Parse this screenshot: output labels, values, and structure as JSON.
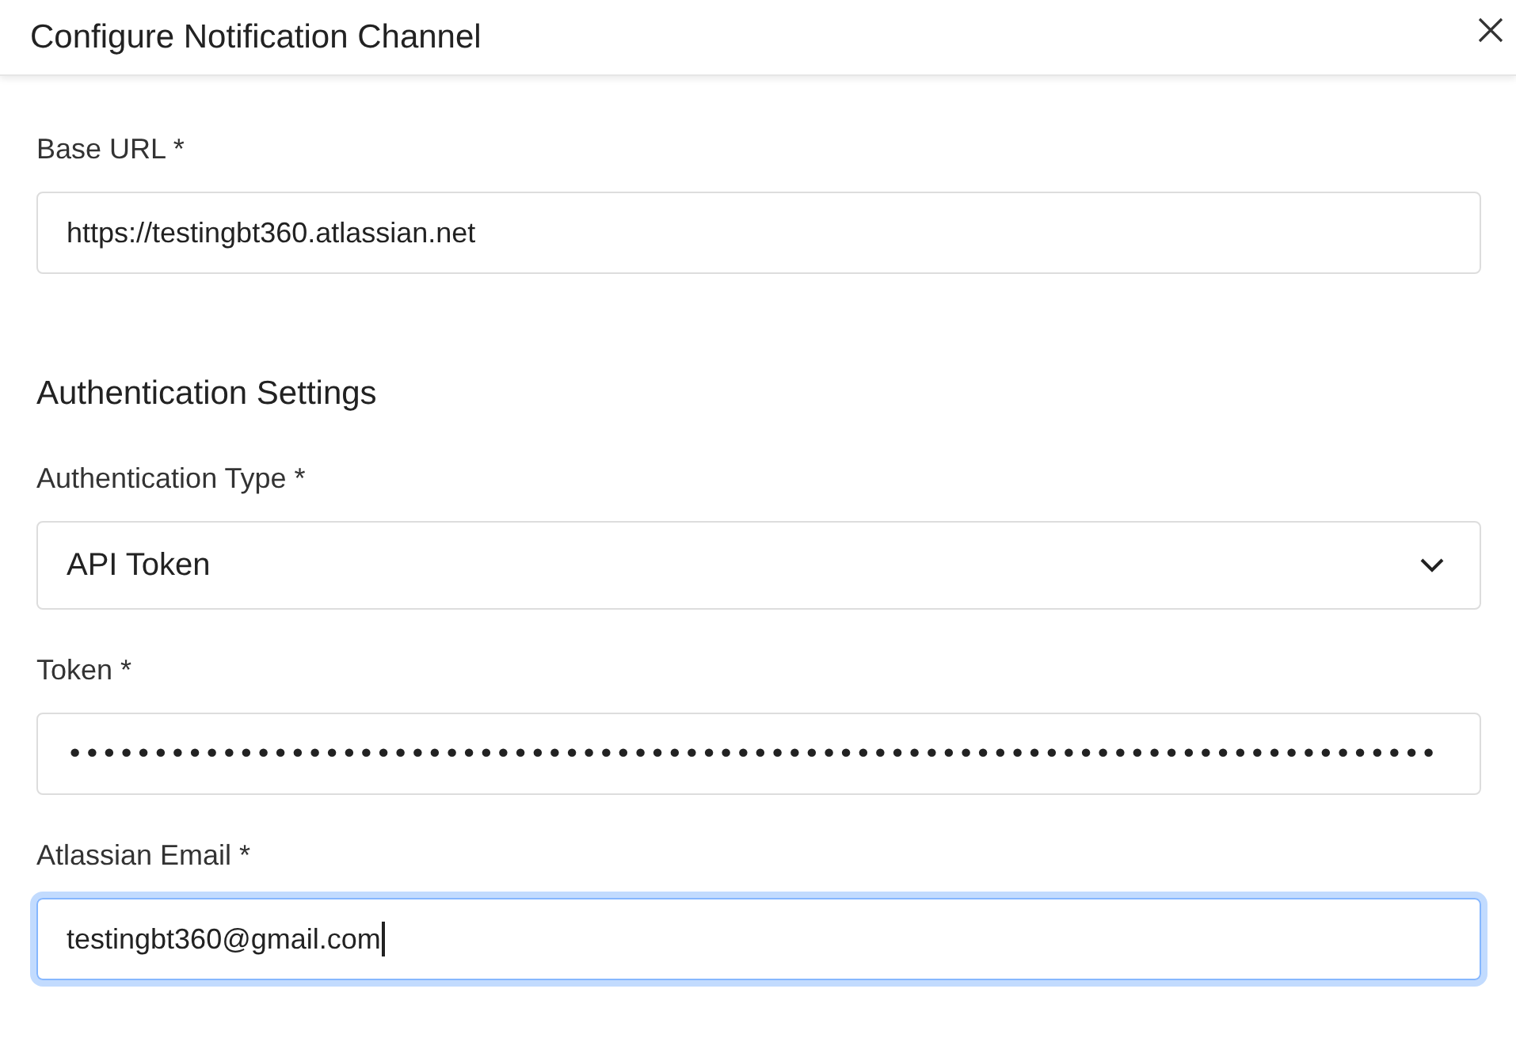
{
  "dialog": {
    "title": "Configure Notification Channel"
  },
  "sections": [
    {
      "fields": [
        {
          "kind": "text",
          "label": "Base URL *",
          "value": "https://testingbt360.atlassian.net",
          "focused": false
        }
      ]
    },
    {
      "heading": "Authentication Settings",
      "fields": [
        {
          "kind": "select",
          "label": "Authentication Type *",
          "value": "API Token",
          "focused": false
        },
        {
          "kind": "password",
          "label": "Token *",
          "value": "••••••••••••••••••••••••••••••••••••••••••••••••••••••••••••••••••••••••••••••••",
          "focused": false
        },
        {
          "kind": "text",
          "label": "Atlassian Email *",
          "value": "testingbt360@gmail.com",
          "focused": true
        }
      ]
    }
  ]
}
